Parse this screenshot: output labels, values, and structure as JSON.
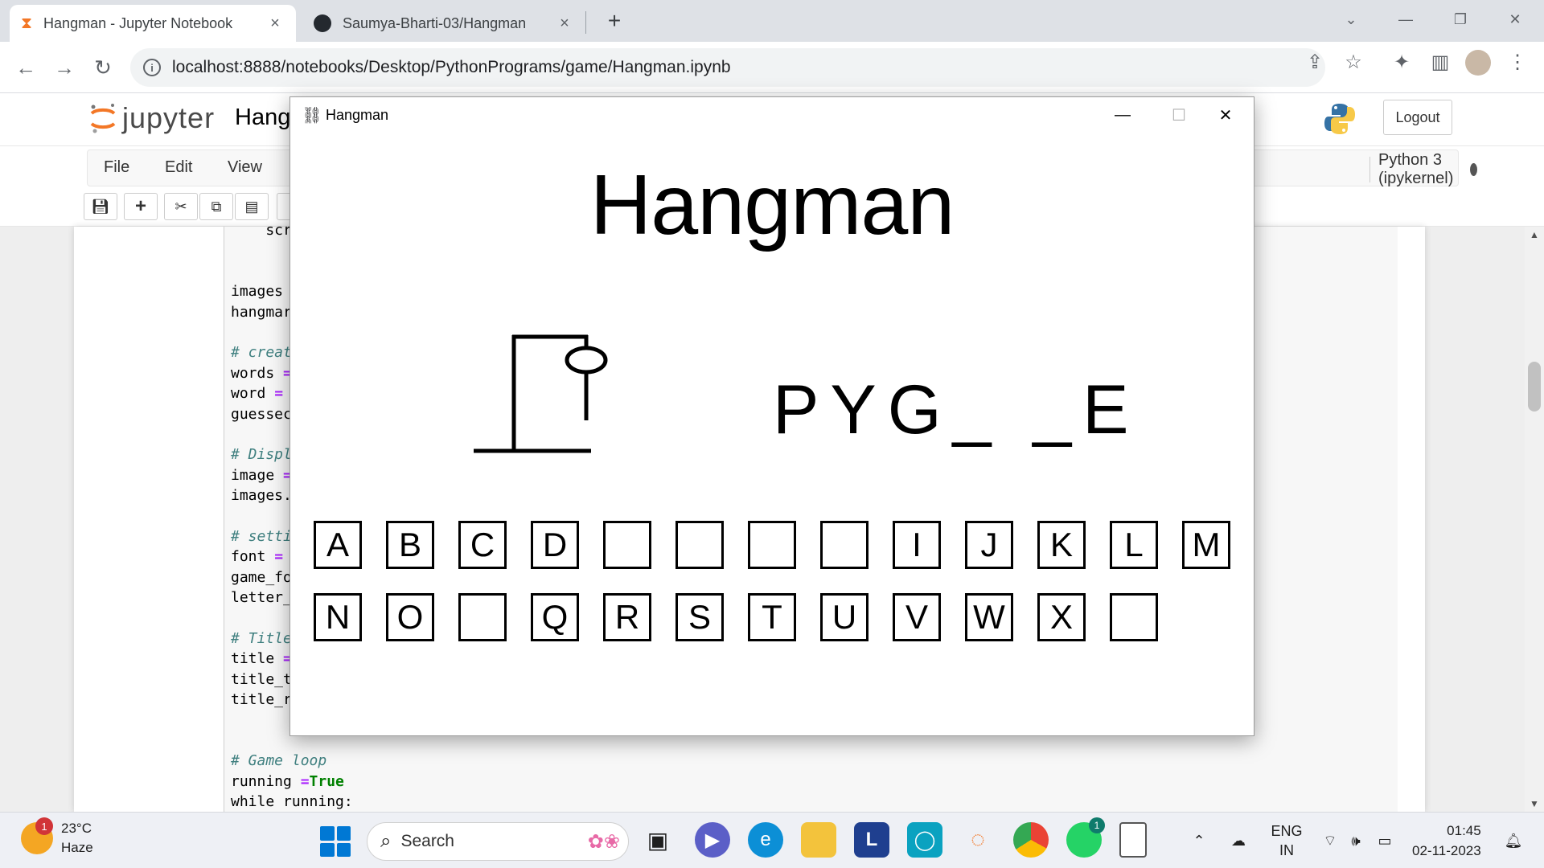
{
  "browser": {
    "tabs": [
      {
        "title": "Hangman - Jupyter Notebook",
        "active": true
      },
      {
        "title": "Saumya-Bharti-03/Hangman",
        "active": false
      }
    ],
    "url": "localhost:8888/notebooks/Desktop/PythonPrograms/game/Hangman.ipynb"
  },
  "jupyter": {
    "logo_text": "jupyter",
    "notebook_title": "Hang",
    "logout_label": "Logout",
    "menu": [
      "File",
      "Edit",
      "View"
    ],
    "kernel": "Python 3 (ipykernel)",
    "code_lines": [
      {
        "text": "    scr",
        "style": "plain"
      },
      {
        "text": "",
        "style": "plain"
      },
      {
        "text": "",
        "style": "plain"
      },
      {
        "text": "images",
        "style": "plain"
      },
      {
        "text": "hangmar",
        "style": "plain"
      },
      {
        "text": "",
        "style": "plain"
      },
      {
        "text": "# creat",
        "style": "comment"
      },
      {
        "text": "words ",
        "style": "plain",
        "op": "="
      },
      {
        "text": "word ",
        "style": "plain",
        "op": "="
      },
      {
        "text": "guessec",
        "style": "plain"
      },
      {
        "text": "",
        "style": "plain"
      },
      {
        "text": "# Displ",
        "style": "comment"
      },
      {
        "text": "image ",
        "style": "plain",
        "op": "="
      },
      {
        "text": "images.",
        "style": "plain"
      },
      {
        "text": "",
        "style": "plain"
      },
      {
        "text": "# setti",
        "style": "comment"
      },
      {
        "text": "font ",
        "style": "plain",
        "op": "="
      },
      {
        "text": "game_fo",
        "style": "plain"
      },
      {
        "text": "letter_",
        "style": "plain"
      },
      {
        "text": "",
        "style": "plain"
      },
      {
        "text": "# Title",
        "style": "comment"
      },
      {
        "text": "title ",
        "style": "plain",
        "op": "="
      },
      {
        "text": "title_t",
        "style": "plain"
      },
      {
        "text": "title_r",
        "style": "plain"
      },
      {
        "text": "",
        "style": "plain"
      },
      {
        "text": "",
        "style": "plain"
      },
      {
        "text": "# Game loop",
        "style": "comment"
      },
      {
        "text": "running ",
        "style": "plain",
        "op": "=",
        "kw": "True"
      },
      {
        "text": "while running:",
        "style": "plain"
      }
    ]
  },
  "game": {
    "window_title": "Hangman",
    "heading": "Hangman",
    "word_display": "PYG_ _E",
    "letters_row1": [
      "A",
      "B",
      "C",
      "D",
      "",
      "",
      "",
      "",
      "I",
      "J",
      "K",
      "L",
      "M"
    ],
    "letters_row2": [
      "N",
      "O",
      "",
      "Q",
      "R",
      "S",
      "T",
      "U",
      "V",
      "W",
      "X",
      ""
    ]
  },
  "taskbar": {
    "weather_temp": "23°C",
    "weather_desc": "Haze",
    "weather_badge": "1",
    "search_label": "Search",
    "whatsapp_badge": "1",
    "lang_line1": "ENG",
    "lang_line2": "IN",
    "time": "01:45",
    "date": "02-11-2023"
  }
}
